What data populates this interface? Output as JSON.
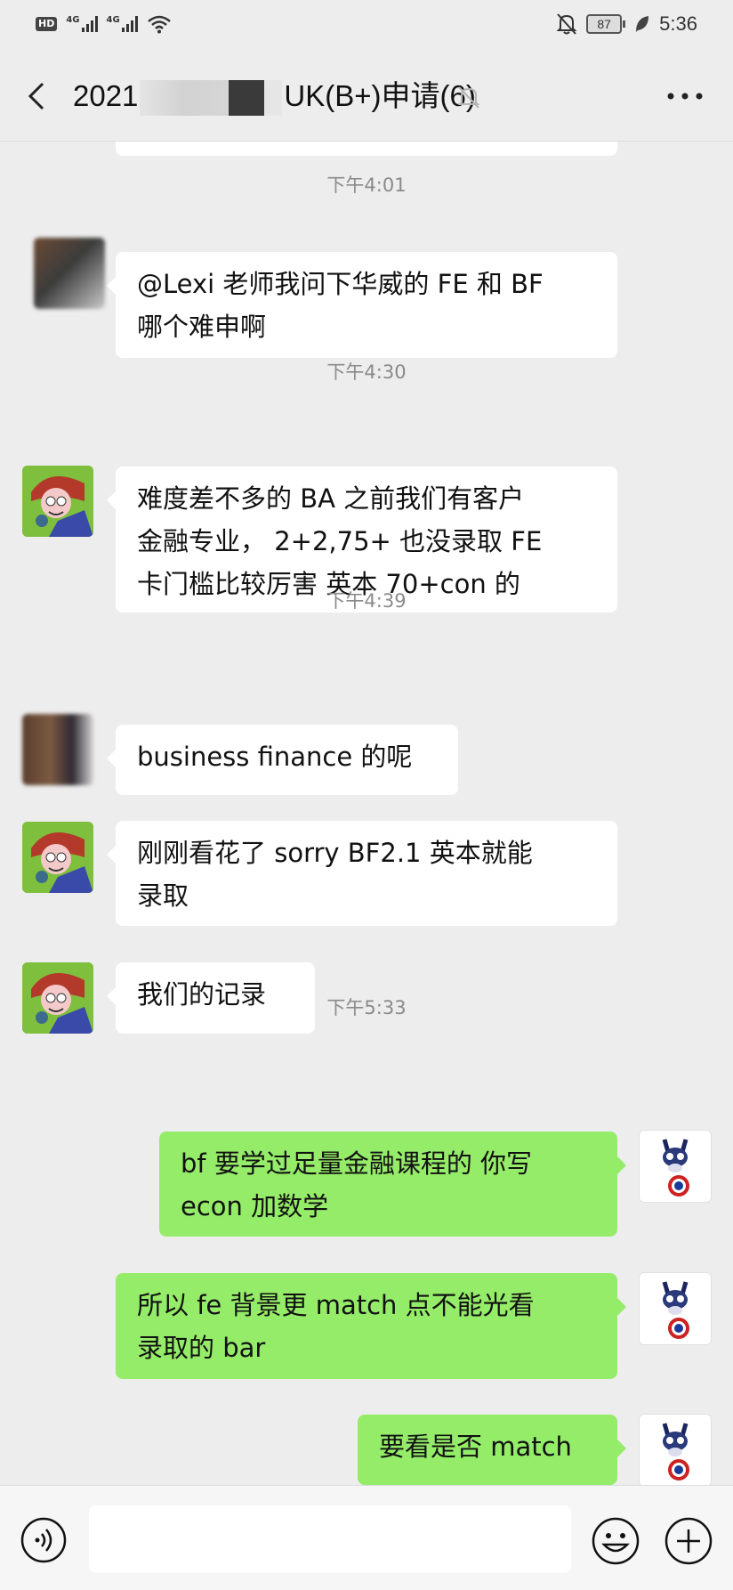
{
  "status_bar": {
    "hd": "HD",
    "net1": "4G",
    "net2": "4G",
    "battery": "87",
    "time": "5:36"
  },
  "header": {
    "title_start": "2021",
    "title_end": "UK(B+)申请(6)",
    "icons": [
      "back-arrow-icon",
      "mute-bell-icon",
      "more-icon"
    ]
  },
  "messages": [
    {
      "type": "time",
      "text": "下午4:01"
    },
    {
      "type": "in",
      "lines": [
        "@Lexi  老师我问下华威的 FE 和 BF",
        "哪个难申啊"
      ]
    },
    {
      "type": "time",
      "text": "下午4:30"
    },
    {
      "type": "in",
      "lines": [
        "难度差不多的 BA 之前我们有客户",
        "金融专业， 2+2,75+ 也没录取 FE",
        "卡门槛比较厉害 英本 70+con 的"
      ]
    },
    {
      "type": "time",
      "text": "下午4:39"
    },
    {
      "type": "in",
      "lines": [
        "business finance 的呢"
      ]
    },
    {
      "type": "in",
      "lines": [
        "刚刚看花了 sorry BF2.1 英本就能",
        "录取"
      ]
    },
    {
      "type": "in",
      "lines": [
        "我们的记录"
      ]
    },
    {
      "type": "time",
      "text": "下午5:33"
    },
    {
      "type": "out",
      "lines": [
        "bf 要学过足量金融课程的 你写",
        "econ 加数学"
      ]
    },
    {
      "type": "out",
      "lines": [
        "所以 fe 背景更 match 点不能光看",
        "录取的 bar"
      ]
    },
    {
      "type": "out",
      "lines": [
        "要看是否 match"
      ]
    }
  ],
  "colors": {
    "background": "#ededed",
    "bubble_in": "#ffffff",
    "bubble_out": "#95ec69",
    "timestamp": "#8a8a8a"
  },
  "input_bar": {
    "icons": [
      "voice-icon",
      "emoji-icon",
      "plus-icon"
    ]
  }
}
